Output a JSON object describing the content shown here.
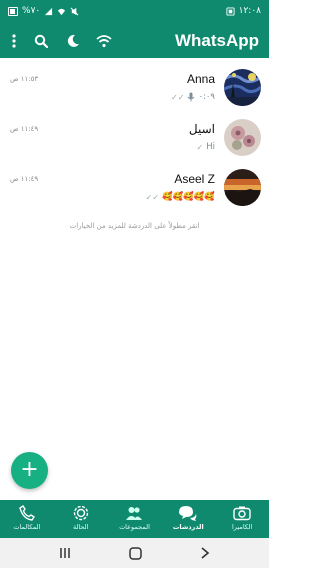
{
  "status_bar": {
    "time": "١٢:٠٨",
    "battery": "%٧٠",
    "accent": "#0f8a6e"
  },
  "app_bar": {
    "title": "WhatsApp",
    "icons": [
      "more-vert-icon",
      "search-icon",
      "moon-icon",
      "wifi-icon"
    ]
  },
  "chats": [
    {
      "name": "Anna",
      "time": "١١:٥٣ ص",
      "preview": "٠:٠٩",
      "preview_type": "voice",
      "avatar": "starry-night"
    },
    {
      "name": "اسيل",
      "time": "١١:٤٩ ص",
      "preview": "Hi",
      "preview_type": "text",
      "avatar": "flowers"
    },
    {
      "name": "Aseel Z",
      "time": "١١:٤٩ ص",
      "preview": "🥰🥰🥰🥰🥰",
      "preview_type": "text",
      "avatar": "sunset"
    }
  ],
  "hint": "انقر مطولاً على الدردشة للمزيد من الخيارات",
  "fab": {
    "label": "+"
  },
  "bottom_nav": [
    {
      "label": "المكالمات",
      "icon": "phone-icon"
    },
    {
      "label": "الحالة",
      "icon": "status-icon"
    },
    {
      "label": "المجموعات",
      "icon": "groups-icon"
    },
    {
      "label": "الدردشات",
      "icon": "chats-icon",
      "active": true
    },
    {
      "label": "الكاميرا",
      "icon": "camera-icon"
    }
  ]
}
